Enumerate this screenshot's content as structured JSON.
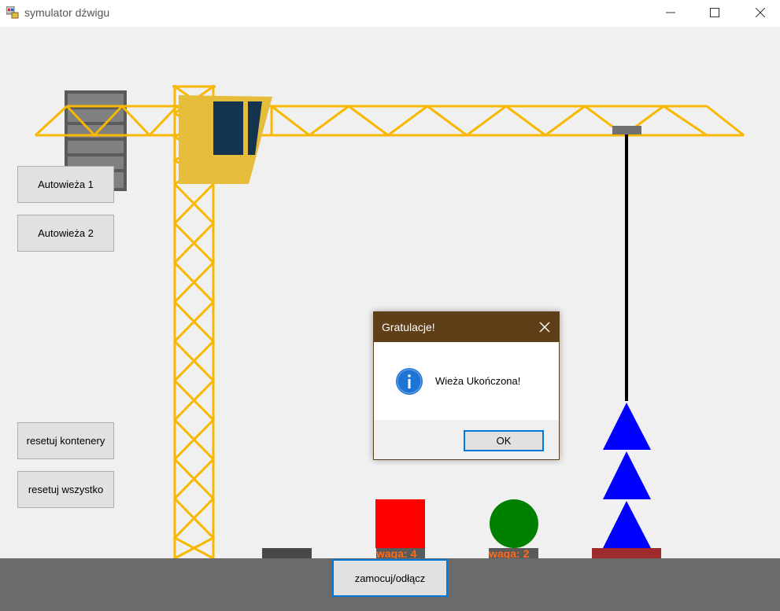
{
  "window": {
    "title": "symulator dźwigu",
    "controls": {
      "minimize": "minimize-icon",
      "maximize": "maximize-icon",
      "close": "close-icon"
    }
  },
  "buttons": {
    "autotower1": "Autowieża 1",
    "autotower2": "Autowieża 2",
    "reset_containers": "resetuj kontenery",
    "reset_all": "resetuj wszystko",
    "attach_detach": "zamocuj/odłącz"
  },
  "scene": {
    "crane_color": "#f9b800",
    "cabin_color": "#e5bd3b",
    "window_color": "#14334f",
    "counterweight_color": "#5a5a5a",
    "ground_color": "#6b6b6b",
    "objects": [
      {
        "shape": "square",
        "color": "#ff0000",
        "weight_label": "waga: 4"
      },
      {
        "shape": "circle",
        "color": "#008000",
        "weight_label": "waga: 2"
      }
    ],
    "tower_stack": {
      "shape": "triangle",
      "color": "#0000ff",
      "count": 3,
      "base_color": "#9e2a2b"
    }
  },
  "dialog": {
    "title": "Gratulacje!",
    "message": "Wieża Ukończona!",
    "ok_label": "OK",
    "icon": "info-icon",
    "title_color": "#5e3f18"
  }
}
